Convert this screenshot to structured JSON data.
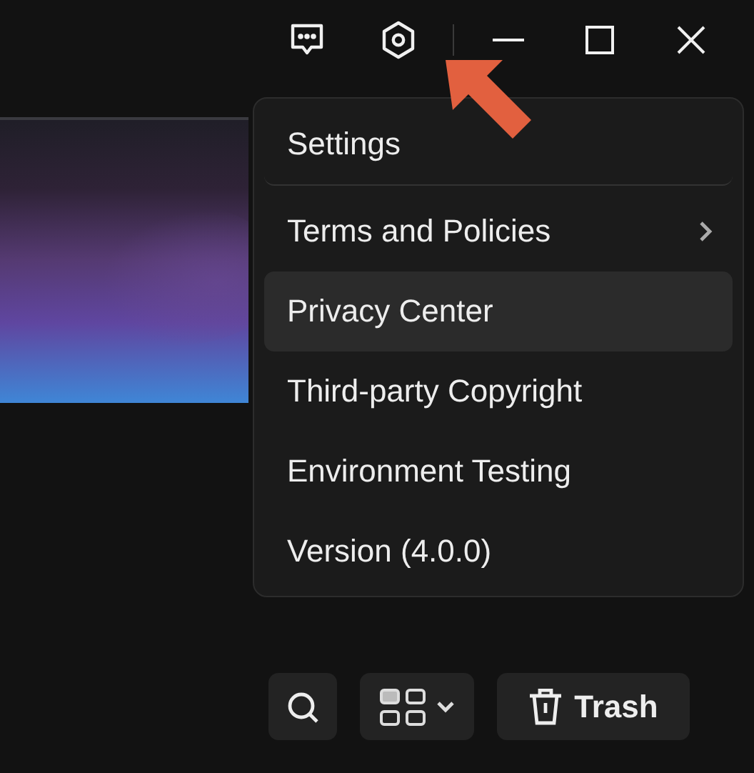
{
  "menu": {
    "items": [
      {
        "kind": "header",
        "label": "Settings",
        "selected": false
      },
      {
        "kind": "submenu",
        "label": "Terms and Policies",
        "selected": false
      },
      {
        "kind": "item",
        "label": "Privacy Center",
        "selected": true
      },
      {
        "kind": "item",
        "label": "Third-party Copyright",
        "selected": false
      },
      {
        "kind": "item",
        "label": "Environment Testing",
        "selected": false
      },
      {
        "kind": "item",
        "label": "Version (4.0.0)",
        "selected": false
      }
    ]
  },
  "toolbar": {
    "trash_label": "Trash"
  }
}
